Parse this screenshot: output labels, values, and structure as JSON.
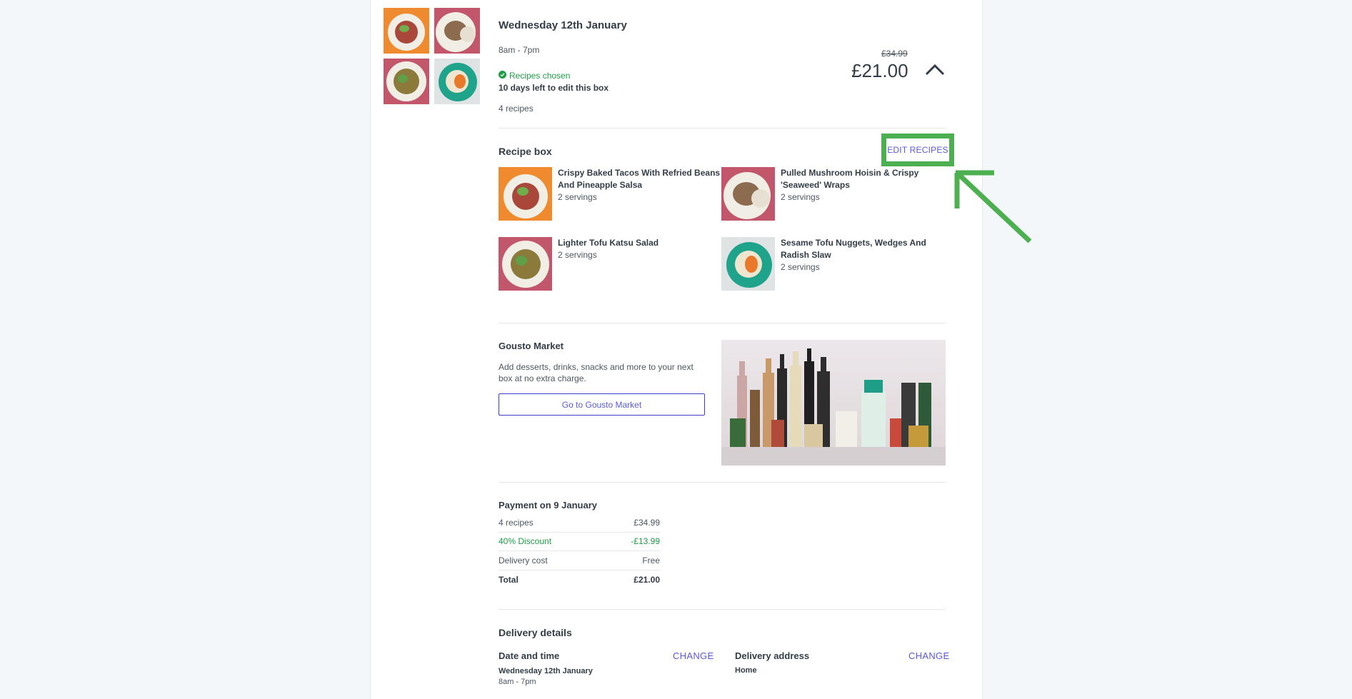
{
  "delivery": {
    "title": "Wednesday 12th January",
    "time": "8am - 7pm",
    "status": "Recipes chosen",
    "edit_note": "10 days left to edit this box",
    "recipe_count": "4 recipes",
    "old_price": "£34.99",
    "price": "£21.00"
  },
  "recipe_box": {
    "title": "Recipe box",
    "edit_label": "EDIT RECIPES",
    "recipes": [
      {
        "name_line1": "Crispy Baked Tacos With Refried Beans",
        "name_line2": "And Pineapple Salsa",
        "servings": "2 servings"
      },
      {
        "name_line1": "Pulled Mushroom Hoisin & Crispy",
        "name_line2": "'Seaweed' Wraps",
        "servings": "2 servings"
      },
      {
        "name_line1": "Lighter Tofu Katsu Salad",
        "name_line2": "",
        "servings": "2 servings"
      },
      {
        "name_line1": "Sesame Tofu Nuggets, Wedges And",
        "name_line2": "Radish Slaw",
        "servings": "2 servings"
      }
    ]
  },
  "market": {
    "title": "Gousto Market",
    "desc_line1": "Add desserts, drinks, snacks and more to your next",
    "desc_line2": "box at no extra charge.",
    "button": "Go to Gousto Market"
  },
  "payment": {
    "title": "Payment on 9 January",
    "rows": [
      {
        "label": "4 recipes",
        "value": "£34.99"
      },
      {
        "label": "40% Discount",
        "value": "-£13.99"
      },
      {
        "label": "Delivery cost",
        "value": "Free"
      },
      {
        "label": "Total",
        "value": "£21.00"
      }
    ]
  },
  "delivery_details": {
    "title": "Delivery details",
    "date_label": "Date and time",
    "date_change": "CHANGE",
    "date_value": "Wednesday 12th January",
    "time_value": "8am - 7pm",
    "address_label": "Delivery address",
    "address_change": "CHANGE",
    "address_value": "Home"
  },
  "colors": {
    "accent_link": "#5a5ad9",
    "success": "#1e9e46",
    "annotation": "#4caf50"
  },
  "icons": {
    "status": "check-circle-icon",
    "collapse": "chevron-up-icon",
    "annotation": "arrow-annotation-icon"
  }
}
